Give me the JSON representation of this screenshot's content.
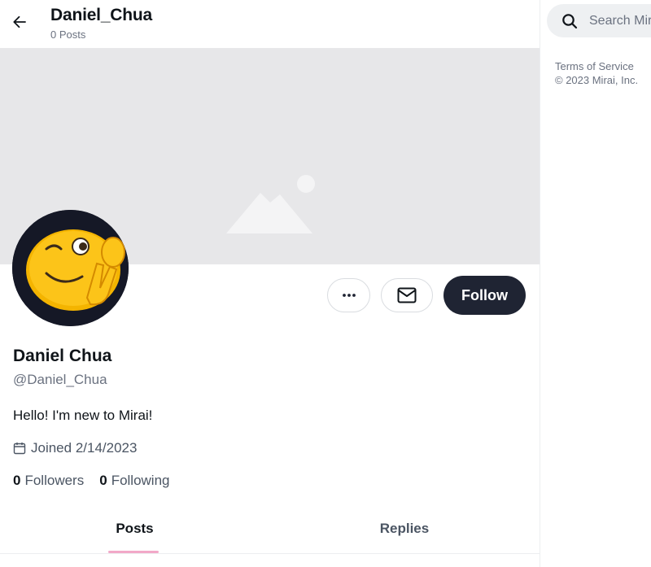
{
  "header": {
    "title": "Daniel_Chua",
    "post_count": "0 Posts"
  },
  "profile": {
    "display_name": "Daniel Chua",
    "handle": "@Daniel_Chua",
    "bio": "Hello! I'm new to Mirai!",
    "joined": "Joined 2/14/2023",
    "followers_count": "0",
    "followers_label": "Followers",
    "following_count": "0",
    "following_label": "Following"
  },
  "actions": {
    "more_icon": "more-horizontal-icon",
    "message_icon": "mail-icon",
    "follow_label": "Follow"
  },
  "tabs": [
    {
      "label": "Posts",
      "active": true
    },
    {
      "label": "Replies",
      "active": false
    }
  ],
  "sidebar": {
    "search_placeholder": "Search Mirai",
    "terms_link": "Terms of Service",
    "copyright": "© 2023 Mirai, Inc."
  },
  "colors": {
    "follow_button_bg": "#1f2433",
    "tab_indicator": "#f2a8c8",
    "banner_bg": "#e7e7e9"
  }
}
